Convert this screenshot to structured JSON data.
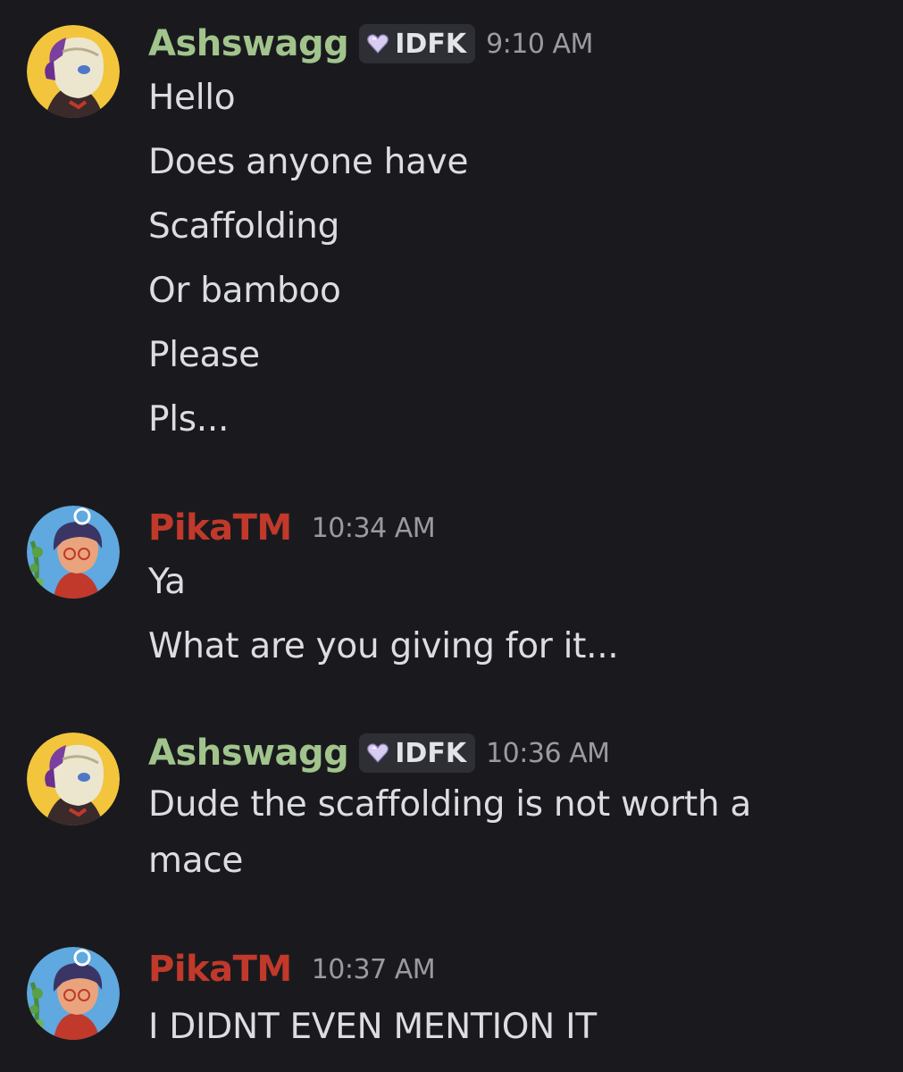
{
  "colors": {
    "background": "#1a1a1e",
    "ashswagg_name": "#a1c48d",
    "pika_name": "#c0392b",
    "timestamp": "#9a9ba1",
    "message_text": "#dcdde1",
    "tag_bg": "#2e2f35"
  },
  "messages": [
    {
      "username": "Ashswagg",
      "tag_icon": "heart-gem-icon",
      "tag_label": "IDFK",
      "time": "9:10 AM",
      "lines": [
        "Hello",
        "Does anyone have",
        "Scaffolding",
        "Or bamboo",
        "Please",
        "Pls..."
      ]
    },
    {
      "username": "PikaTM",
      "time": "10:34 AM",
      "lines": [
        "Ya",
        "What are you giving for it..."
      ]
    },
    {
      "username": "Ashswagg",
      "tag_icon": "heart-gem-icon",
      "tag_label": "IDFK",
      "time": "10:36 AM",
      "lines": [
        "Dude the scaffolding is not worth a",
        "mace"
      ]
    },
    {
      "username": "PikaTM",
      "time": "10:37 AM",
      "lines": [
        "I DIDNT EVEN MENTION IT"
      ]
    }
  ]
}
